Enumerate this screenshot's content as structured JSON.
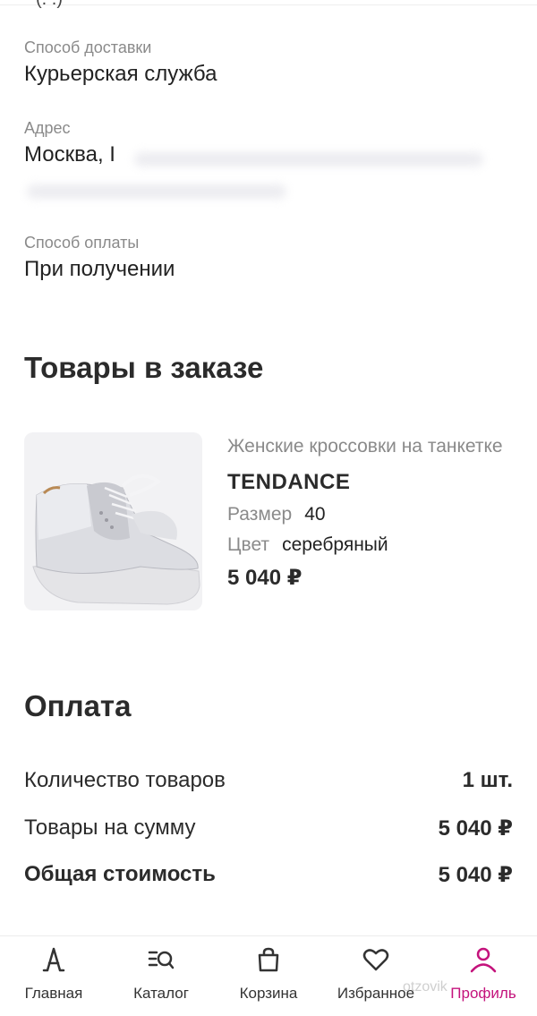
{
  "delivery": {
    "method_label": "Способ доставки",
    "method_value": "Курьерская служба",
    "address_label": "Адрес",
    "address_value": "Москва, I",
    "payment_label": "Способ оплаты",
    "payment_value": "При получении"
  },
  "items_section": {
    "title": "Товары в заказе",
    "product": {
      "name": "Женские кроссовки на танкетке",
      "brand": "TENDANCE",
      "size_label": "Размер",
      "size_value": "40",
      "color_label": "Цвет",
      "color_value": "серебряный",
      "price": "5 040 ₽",
      "image_icon": "sneaker-image"
    }
  },
  "payment": {
    "title": "Оплата",
    "rows": [
      {
        "label": "Количество товаров",
        "value": "1 шт."
      },
      {
        "label": "Товары на сумму",
        "value": "5 040 ₽"
      },
      {
        "label": "Общая стоимость",
        "value": "5 040 ₽"
      }
    ]
  },
  "nav": {
    "items": [
      {
        "label": "Главная",
        "icon": "home-tower-icon"
      },
      {
        "label": "Каталог",
        "icon": "catalog-search-icon"
      },
      {
        "label": "Корзина",
        "icon": "bag-icon"
      },
      {
        "label": "Избранное",
        "icon": "heart-icon"
      },
      {
        "label": "Профиль",
        "icon": "profile-icon"
      }
    ],
    "active_index": 4,
    "active_color": "#c4137c"
  },
  "watermark": "otzovik"
}
